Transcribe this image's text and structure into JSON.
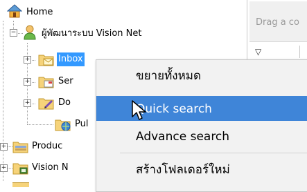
{
  "tree": {
    "root_label": "Home",
    "user_label": "ผู้พัฒนาระบบ Vision Net",
    "items": [
      {
        "label": "Inbox"
      },
      {
        "label": "Ser"
      },
      {
        "label": "Do"
      },
      {
        "label": "Pul"
      }
    ],
    "products_label": "Produc",
    "vision_label": "Vision N"
  },
  "right_pane": {
    "drag_hint": "Drag a co"
  },
  "context_menu": {
    "items": [
      {
        "label": "ขยายทั้งหมด"
      },
      {
        "label": "Quick search",
        "highlighted": true
      },
      {
        "label": "Advance search"
      },
      {
        "label": "สร้างโฟลเดอร์ใหม่"
      }
    ]
  },
  "colors": {
    "selection": "#3399ff",
    "menu_highlight": "#3f85d8",
    "menu_background": "#f2f2f2"
  }
}
